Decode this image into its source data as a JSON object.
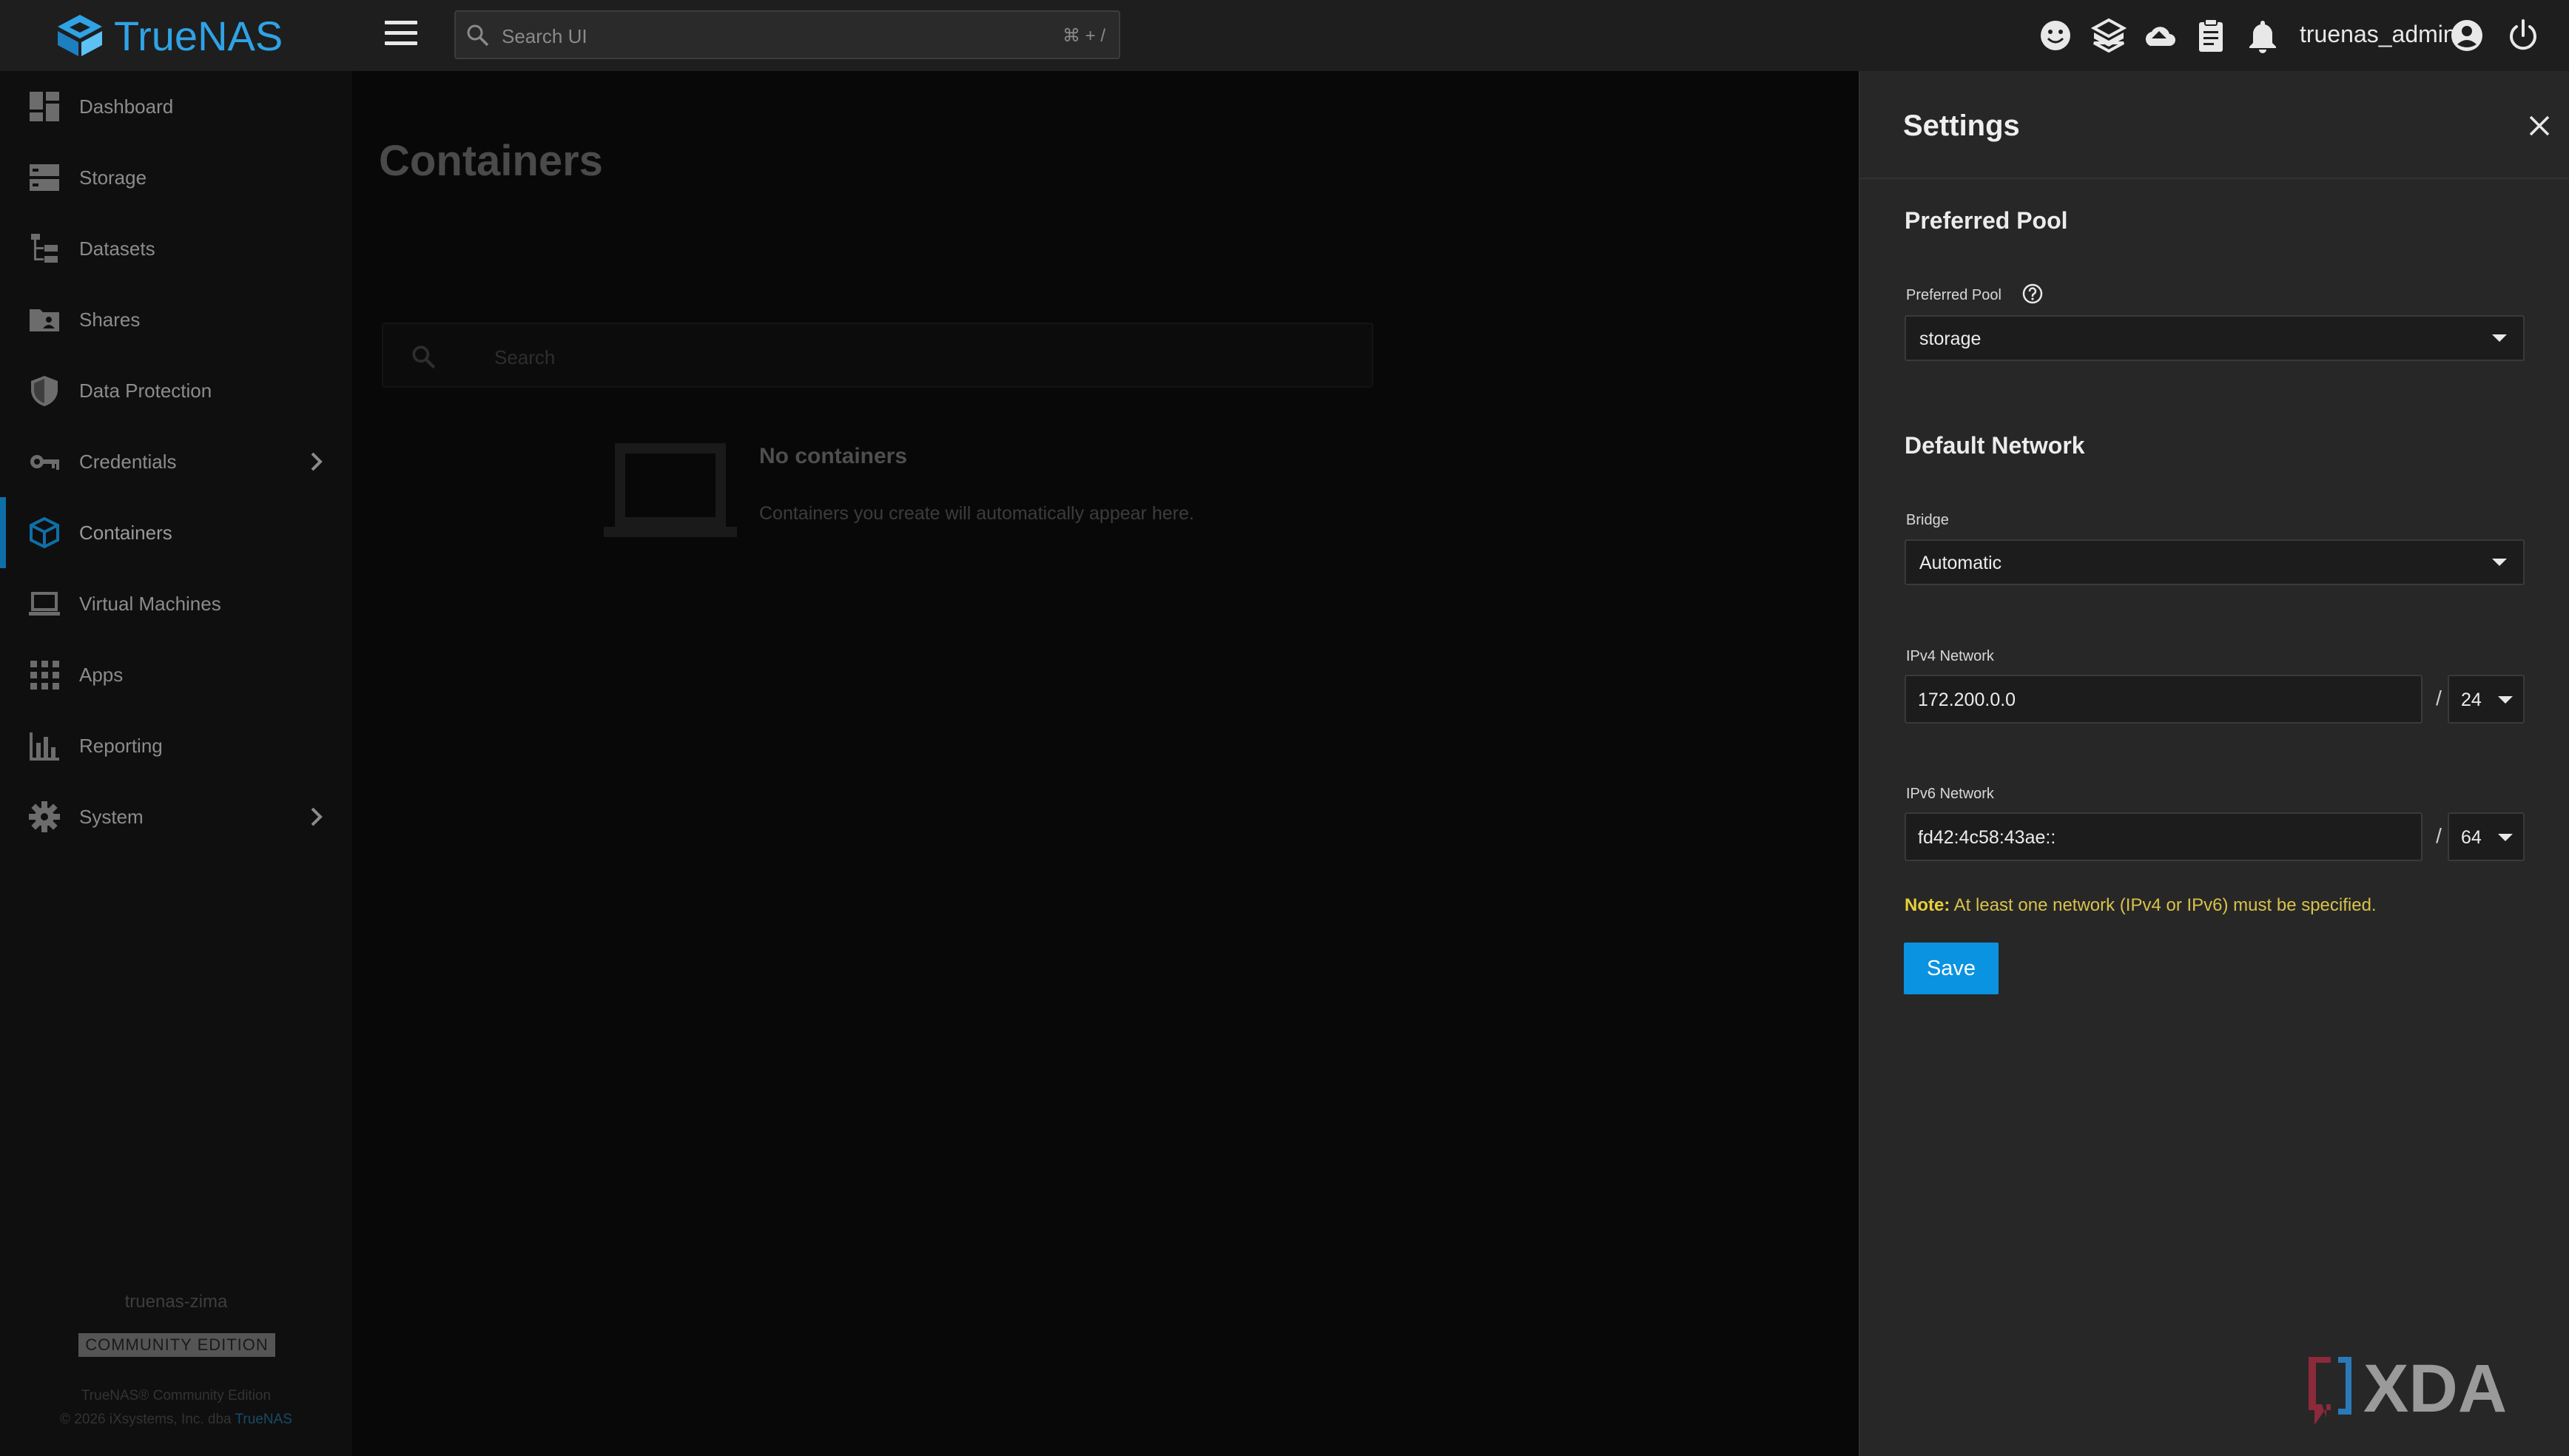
{
  "app": {
    "brand": "TrueNAS",
    "username": "truenas_admin"
  },
  "topbar": {
    "search_placeholder": "Search UI",
    "search_shortcut": "⌘ + /",
    "icons": [
      "feedback-icon",
      "truecommand-icon",
      "cloud-sync-icon",
      "jobs-icon",
      "notifications-icon",
      "account-icon",
      "power-icon"
    ]
  },
  "sidebar": {
    "items": [
      {
        "label": "Dashboard",
        "icon": "dashboard-icon"
      },
      {
        "label": "Storage",
        "icon": "storage-icon"
      },
      {
        "label": "Datasets",
        "icon": "datasets-icon"
      },
      {
        "label": "Shares",
        "icon": "shares-icon"
      },
      {
        "label": "Data Protection",
        "icon": "shield-icon"
      },
      {
        "label": "Credentials",
        "icon": "key-icon"
      },
      {
        "label": "Containers",
        "icon": "cube-icon"
      },
      {
        "label": "Virtual Machines",
        "icon": "laptop-icon"
      },
      {
        "label": "Apps",
        "icon": "apps-grid-icon"
      },
      {
        "label": "Reporting",
        "icon": "bar-chart-icon"
      },
      {
        "label": "System",
        "icon": "gear-icon"
      }
    ],
    "active": "Containers",
    "hostname": "truenas-zima",
    "edition": "COMMUNITY EDITION",
    "footer_line1": "TrueNAS® Community Edition",
    "footer_line2_prefix": "© 2026 iXsystems, Inc. dba ",
    "footer_line2_link": "TrueNAS"
  },
  "main": {
    "title": "Containers",
    "search_placeholder": "Search",
    "empty_title": "No containers",
    "empty_subtitle": "Containers you create will automatically appear here."
  },
  "settings": {
    "title": "Settings",
    "pool_section": "Preferred Pool",
    "pool_label": "Preferred Pool",
    "pool_value": "storage",
    "network_section": "Default Network",
    "bridge_label": "Bridge",
    "bridge_value": "Automatic",
    "ipv4_label": "IPv4 Network",
    "ipv4_value": "172.200.0.0",
    "ipv4_mask": "24",
    "ipv6_label": "IPv6 Network",
    "ipv6_value": "fd42:4c58:43ae::",
    "ipv6_mask": "64",
    "separator": "/",
    "note_label": "Note:",
    "note_text": " At least one network (IPv4 or IPv6) must be specified.",
    "save_label": "Save"
  },
  "colors": {
    "accent": "#0a93e0",
    "brand": "#2fa3e6",
    "note": "#d8c24a"
  }
}
